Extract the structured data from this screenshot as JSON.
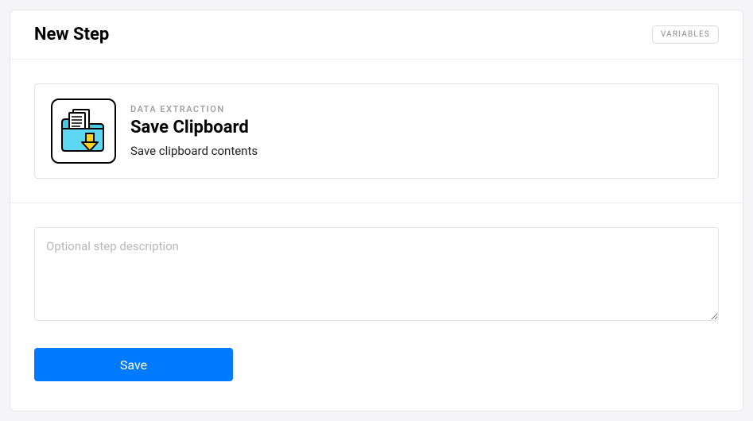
{
  "header": {
    "title": "New Step",
    "variables_label": "VARIABLES"
  },
  "step": {
    "category": "DATA EXTRACTION",
    "title": "Save Clipboard",
    "subtitle": "Save clipboard contents",
    "icon": "clipboard-save-icon"
  },
  "description": {
    "value": "",
    "placeholder": "Optional step description"
  },
  "actions": {
    "save_label": "Save"
  },
  "colors": {
    "primary": "#007aff",
    "folder": "#5ed7f2",
    "arrow": "#ffd21f"
  }
}
